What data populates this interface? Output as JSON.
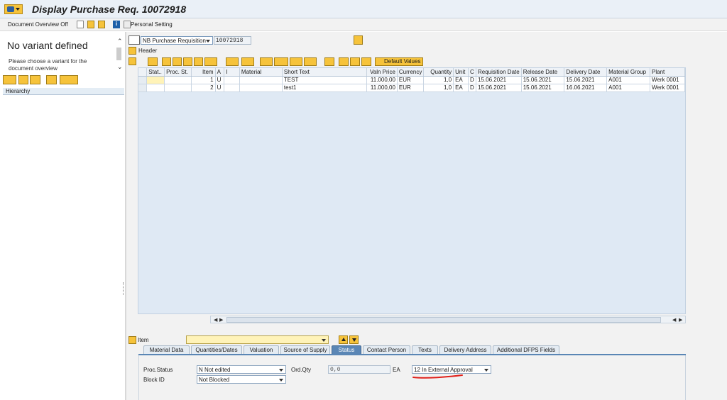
{
  "window": {
    "title": "Display Purchase Req. 10072918"
  },
  "toolbar": {
    "doc_overview_label": "Document Overview Off",
    "personal_setting_label": "Personal Setting"
  },
  "left_panel": {
    "title": "No variant defined",
    "description": "Please choose a variant for the document overview",
    "hierarchy_label": "Hierarchy"
  },
  "header": {
    "doc_type": "NB Purchase Requisition",
    "doc_number": "10072918",
    "header_label": "Header"
  },
  "grid": {
    "default_values_label": "Default Values",
    "columns": [
      "Stat..",
      "Proc. St.",
      "Item",
      "A",
      "I",
      "Material",
      "Short Text",
      "Valn Price",
      "Currency",
      "Quantity",
      "Unit",
      "C",
      "Requisition Date",
      "Release Date",
      "Delivery Date",
      "Material Group",
      "Plant"
    ],
    "rows": [
      [
        "",
        "",
        "1",
        "U",
        "",
        "",
        "TEST",
        "11.000,00",
        "EUR",
        "1,0",
        "EA",
        "D",
        "15.06.2021",
        "15.06.2021",
        "15.06.2021",
        "A001",
        "Werk 0001"
      ],
      [
        "",
        "",
        "2",
        "U",
        "",
        "",
        "test1",
        "11.000,00",
        "EUR",
        "1,0",
        "EA",
        "D",
        "15.06.2021",
        "15.06.2021",
        "16.06.2021",
        "A001",
        "Werk 0001"
      ]
    ]
  },
  "item_detail": {
    "item_label": "Item",
    "item_value": "",
    "tabs": [
      "Material Data",
      "Quantities/Dates",
      "Valuation",
      "Source of Supply",
      "Status",
      "Contact Person",
      "Texts",
      "Delivery Address",
      "Additional DFPS Fields"
    ],
    "active_tab": "Status",
    "proc_status_label": "Proc.Status",
    "proc_status_value": "N Not edited",
    "block_id_label": "Block ID",
    "block_id_value": "Not Blocked",
    "ord_qty_label": "Ord.Qty",
    "ord_qty_value": "0,0",
    "ord_qty_unit": "EA",
    "approval_value": "12 In External Approval"
  },
  "colors": {
    "title_bar": "#eaf0f7",
    "active_tab": "#5a86b5",
    "sap_yellow": "#f6c33b",
    "grid_bg": "#dfe9f4",
    "annotation_red": "#e0201a"
  }
}
